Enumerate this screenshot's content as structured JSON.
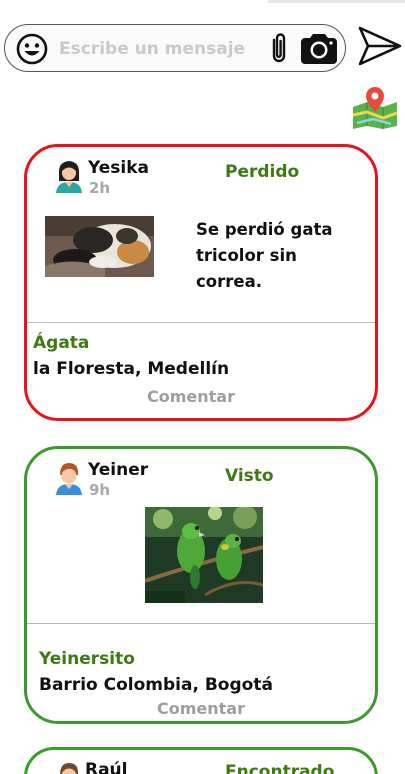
{
  "composer": {
    "placeholder": "Escribe un mensaje",
    "icons": [
      "emoji-icon",
      "paperclip-icon",
      "camera-icon",
      "send-icon"
    ]
  },
  "map_icon": "map-pin-icon",
  "posts": [
    {
      "user": "Yesika",
      "time": "2h",
      "status": "Perdido",
      "description": "Se perdió gata tricolor sin correa.",
      "pet_name": "Ágata",
      "location": "la Floresta, Medellín",
      "comment_label": "Comentar",
      "border_color": "#e8141b",
      "photo": "cat-photo"
    },
    {
      "user": "Yeiner",
      "time": "9h",
      "status": "Visto",
      "pet_name": "Yeinersito",
      "location": "Barrio Colombia, Bogotá",
      "comment_label": "Comentar",
      "border_color": "#3a9a2c",
      "photo": "parrots-photo"
    },
    {
      "user": "Raúl",
      "status": "Encontrado",
      "border_color": "#3a9a2c"
    }
  ],
  "colors": {
    "status_green": "#3d7a12",
    "muted_gray": "#a7a7a7"
  }
}
